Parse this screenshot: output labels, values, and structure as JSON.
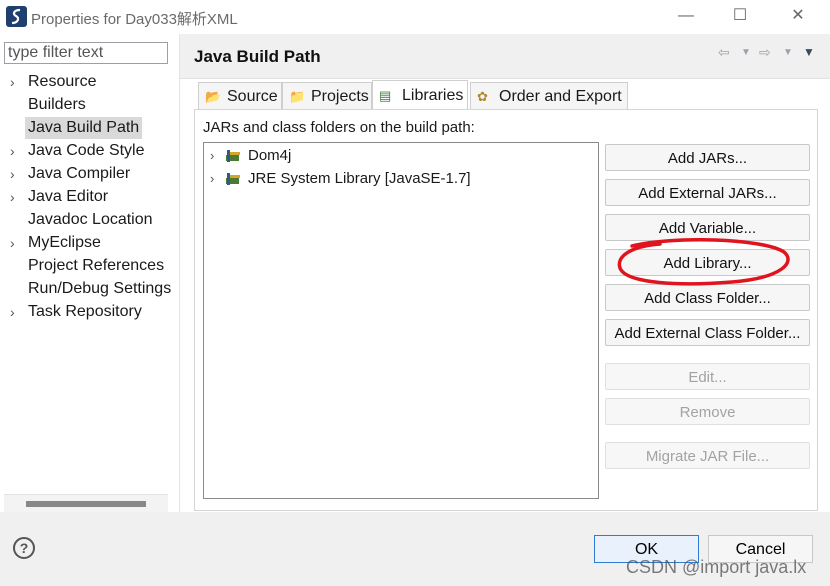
{
  "window": {
    "title": "Properties for Day033解析XML",
    "minimize_icon": "minimize-icon",
    "maximize_icon": "maximize-icon",
    "close_icon": "close-icon"
  },
  "left_pane": {
    "filter_placeholder": "type filter text",
    "items": [
      {
        "label": "Resource",
        "expandable": true
      },
      {
        "label": "Builders",
        "expandable": false
      },
      {
        "label": "Java Build Path",
        "expandable": false,
        "selected": true
      },
      {
        "label": "Java Code Style",
        "expandable": true
      },
      {
        "label": "Java Compiler",
        "expandable": true
      },
      {
        "label": "Java Editor",
        "expandable": true
      },
      {
        "label": "Javadoc Location",
        "expandable": false
      },
      {
        "label": "MyEclipse",
        "expandable": true
      },
      {
        "label": "Project References",
        "expandable": false
      },
      {
        "label": "Run/Debug Settings",
        "expandable": false
      },
      {
        "label": "Task Repository",
        "expandable": true
      }
    ]
  },
  "header": {
    "title": "Java Build Path"
  },
  "tabs": [
    {
      "label": "Source",
      "icon": "source-folder-icon"
    },
    {
      "label": "Projects",
      "icon": "projects-icon"
    },
    {
      "label": "Libraries",
      "icon": "libraries-icon",
      "active": true
    },
    {
      "label": "Order and Export",
      "icon": "order-export-icon"
    }
  ],
  "libraries": {
    "description": "JARs and class folders on the build path:",
    "entries": [
      {
        "label": "Dom4j"
      },
      {
        "label": "JRE System Library [JavaSE-1.7]"
      }
    ],
    "buttons": {
      "add_jars": "Add JARs...",
      "add_external_jars": "Add External JARs...",
      "add_variable": "Add Variable...",
      "add_library": "Add Library...",
      "add_class_folder": "Add Class Folder...",
      "add_external_class_folder": "Add External Class Folder...",
      "edit": "Edit...",
      "remove": "Remove",
      "migrate_jar": "Migrate JAR File..."
    }
  },
  "footer": {
    "ok": "OK",
    "cancel": "Cancel"
  },
  "watermark": "CSDN @import java.lx",
  "colors": {
    "annotation_red": "#e0141e",
    "ok_border": "#2e7cd6"
  }
}
